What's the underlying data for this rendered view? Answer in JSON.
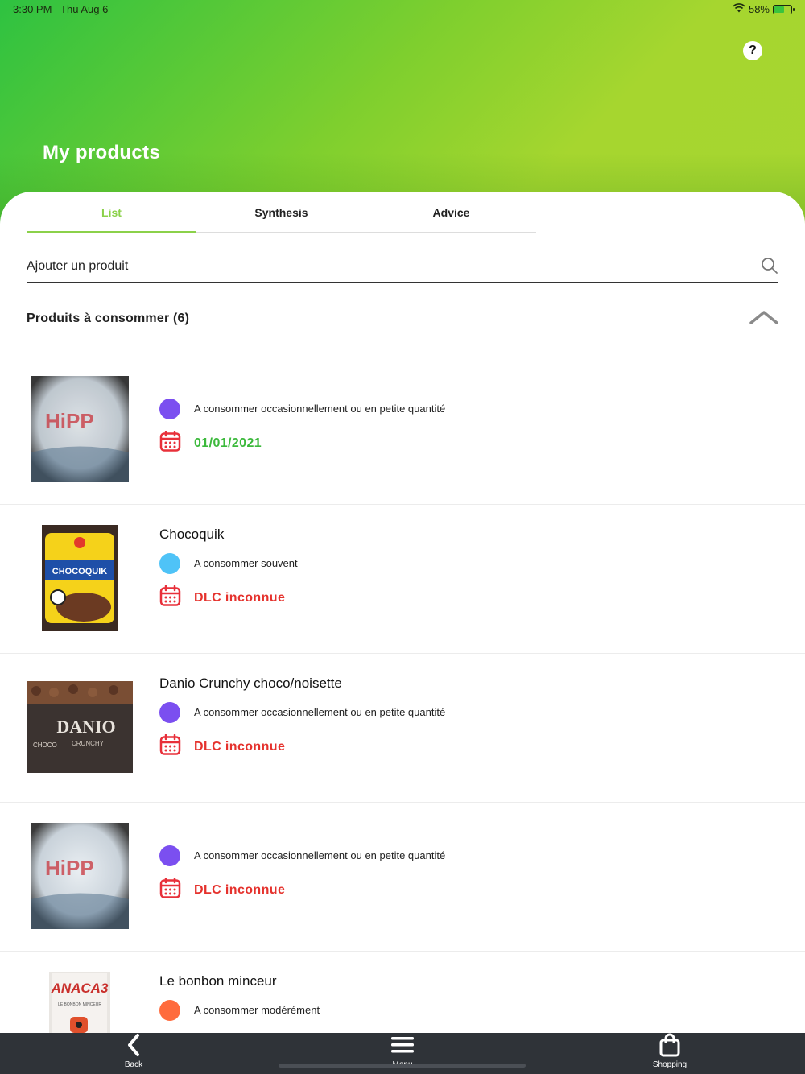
{
  "status": {
    "time": "3:30 PM",
    "date": "Thu Aug 6",
    "battery": "58%"
  },
  "header": {
    "title": "My products",
    "help_label": "?"
  },
  "tabs": [
    {
      "label": "List",
      "active": true
    },
    {
      "label": "Synthesis",
      "active": false
    },
    {
      "label": "Advice",
      "active": false
    }
  ],
  "search": {
    "placeholder": "Ajouter un produit"
  },
  "section": {
    "title": "Produits à consommer (6)"
  },
  "products": [
    {
      "name": "",
      "category": "A consommer occasionnellement ou en petite quantité",
      "dot_color": "#7b4ff0",
      "date": "01/01/2021",
      "date_color": "#3cb93c",
      "thumb": "hipp"
    },
    {
      "name": "Chocoquik",
      "category": "A consommer souvent",
      "dot_color": "#4fc3f7",
      "date": "DLC inconnue",
      "date_color": "#e5322d",
      "thumb": "chocoquik"
    },
    {
      "name": "Danio Crunchy choco/noisette",
      "category": "A consommer occasionnellement ou en petite quantité",
      "dot_color": "#7b4ff0",
      "date": "DLC inconnue",
      "date_color": "#e5322d",
      "thumb": "danio"
    },
    {
      "name": "",
      "category": "A consommer occasionnellement ou en petite quantité",
      "dot_color": "#7b4ff0",
      "date": "DLC inconnue",
      "date_color": "#e5322d",
      "thumb": "hipp"
    },
    {
      "name": "Le bonbon minceur",
      "category": "A consommer modérément",
      "dot_color": "#ff6b3d",
      "date": "",
      "date_color": "#e5322d",
      "thumb": "anaca"
    }
  ],
  "thumb_text": {
    "chocoquik": "CHOCOQUIK",
    "danio": "DANIO",
    "danio_sub": "CRUNCHY",
    "danio_choco": "CHOCO",
    "anaca": "ANACA3",
    "anaca_sub": "LE BONBON MINCEUR",
    "hipp": "HiPP"
  },
  "bottom_nav": {
    "back": "Back",
    "menu": "Menu",
    "shopping": "Shopping"
  },
  "colors": {
    "accent": "#8bd14a",
    "header_start": "#2ec241",
    "header_end": "#a7d630",
    "bottom_bar": "#2f3338",
    "calendar": "#e8303a"
  }
}
